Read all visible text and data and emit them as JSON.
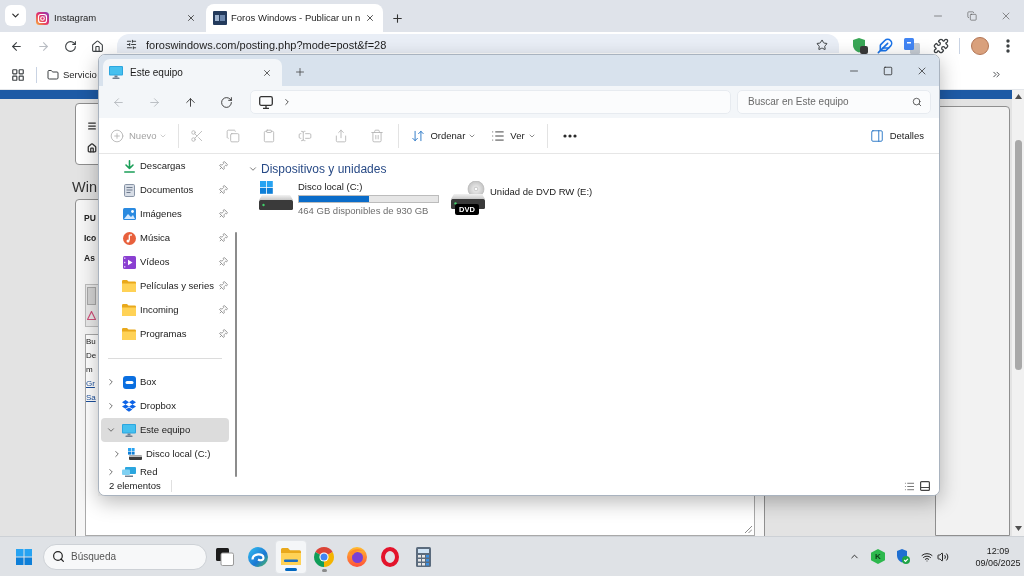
{
  "browser": {
    "tabs": [
      {
        "kind": "camera",
        "title": "Instagram",
        "selected": false
      },
      {
        "kind": "logo",
        "title": "Foros Windows - Publicar un n",
        "selected": true
      }
    ],
    "nav": [
      {
        "kind": "back",
        "disabled": false
      },
      {
        "kind": "forward",
        "disabled": true
      },
      {
        "kind": "reload",
        "disabled": false
      },
      {
        "kind": "home",
        "disabled": false
      }
    ],
    "address": "foroswindows.com/posting.php?mode=post&f=28",
    "bookmarks": [
      {
        "label": "Servicio"
      }
    ]
  },
  "web_page": {
    "heading": "Win",
    "post_labels": [
      "PU",
      "Ico",
      "As"
    ],
    "message_lines": [
      {
        "kind": "text",
        "text": "Bu"
      },
      {
        "kind": "text",
        "text": "De"
      },
      {
        "kind": "text",
        "text": "m"
      },
      {
        "kind": "link",
        "text": "Gr"
      },
      {
        "kind": "link",
        "text": "Sa"
      }
    ]
  },
  "explorer": {
    "tabs": [
      {
        "title": "Este equipo",
        "selected": true
      }
    ],
    "nav": [
      {
        "kind": "back",
        "disabled": true
      },
      {
        "kind": "forward",
        "disabled": true
      },
      {
        "kind": "up",
        "disabled": false
      },
      {
        "kind": "refresh",
        "disabled": false
      }
    ],
    "search": {
      "placeholder": "Buscar en Este equipo"
    },
    "commands": [
      {
        "kind": "new",
        "label": "Nuevo",
        "disabled": true
      },
      {
        "kind": "separator"
      },
      {
        "kind": "cut",
        "disabled": true
      },
      {
        "kind": "copy",
        "disabled": true
      },
      {
        "kind": "paste",
        "disabled": true
      },
      {
        "kind": "rename",
        "disabled": true
      },
      {
        "kind": "share",
        "disabled": true
      },
      {
        "kind": "delete",
        "disabled": true
      },
      {
        "kind": "separator"
      },
      {
        "kind": "sort",
        "label": "Ordenar",
        "disabled": false
      },
      {
        "kind": "view",
        "label": "Ver",
        "disabled": false
      },
      {
        "kind": "separator"
      },
      {
        "kind": "more",
        "disabled": false
      }
    ],
    "details_button": {
      "label": "Detalles"
    },
    "sidebar": {
      "pinned": [
        {
          "label": "Descargas",
          "kind": "downloads",
          "pinned": true,
          "selected": false
        },
        {
          "label": "Documentos",
          "kind": "documents",
          "pinned": true,
          "selected": false
        },
        {
          "label": "Imágenes",
          "kind": "pictures",
          "pinned": true,
          "selected": false
        },
        {
          "label": "Música",
          "kind": "music",
          "pinned": true,
          "selected": false
        },
        {
          "label": "Vídeos",
          "kind": "videos",
          "pinned": true,
          "selected": false
        },
        {
          "label": "Películas y series",
          "kind": "folder",
          "pinned": true,
          "selected": false
        },
        {
          "label": "Incoming",
          "kind": "folder",
          "pinned": true,
          "selected": false
        },
        {
          "label": "Programas",
          "kind": "folder",
          "pinned": true,
          "selected": false
        }
      ],
      "tree": [
        {
          "label": "Box",
          "kind": "box",
          "expanded": false,
          "selected": false
        },
        {
          "label": "Dropbox",
          "kind": "dropbox",
          "expanded": false,
          "selected": false
        },
        {
          "label": "Este equipo",
          "kind": "pc",
          "expanded": true,
          "selected": true,
          "children": [
            {
              "label": "Disco local (C:)",
              "kind": "drive",
              "expanded": false,
              "selected": false
            }
          ]
        },
        {
          "label": "Red",
          "kind": "network",
          "expanded": false,
          "selected": false
        }
      ]
    },
    "group": {
      "title": "Dispositivos y unidades",
      "expanded": true
    },
    "drives": [
      {
        "kind": "hdd",
        "name": "Disco local (C:)",
        "level": 0.5,
        "free": "464 GB disponibles de 930 GB"
      },
      {
        "kind": "dvd",
        "name": "Unidad de DVD RW (E:)",
        "icon_label": "DVD"
      }
    ],
    "status_bar": {
      "count": "2 elementos"
    }
  },
  "taskbar": {
    "search": {
      "placeholder": "Búsqueda"
    },
    "apps": [
      {
        "kind": "squares",
        "running": false,
        "selected": false
      },
      {
        "kind": "wave",
        "running": false,
        "selected": false
      },
      {
        "kind": "folder",
        "running": true,
        "selected": true
      },
      {
        "kind": "tricolor",
        "running": true,
        "selected": false
      },
      {
        "kind": "fox",
        "running": false,
        "selected": false
      },
      {
        "kind": "ring",
        "running": false,
        "selected": false
      },
      {
        "kind": "calculator",
        "running": false,
        "selected": false
      }
    ],
    "tray": {
      "badge_letter": "K",
      "time": "12:09",
      "date": "09/06/2025"
    }
  }
}
